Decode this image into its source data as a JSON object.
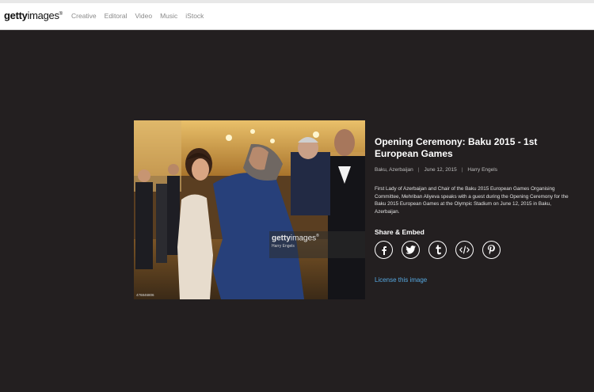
{
  "header": {
    "logo_bold": "getty",
    "logo_regular": "images",
    "logo_reg": "®",
    "nav": [
      "Creative",
      "Editoral",
      "Video",
      "Music",
      "iStock"
    ]
  },
  "image": {
    "watermark_brand_bold": "getty",
    "watermark_brand": "images",
    "watermark_reg": "®",
    "watermark_credit": "Harry Engels",
    "image_id": "476846806"
  },
  "details": {
    "title": "Opening Ceremony: Baku 2015 - 1st European Games",
    "location": "Baku, Azerbaijan",
    "date": "June 12, 2015",
    "photographer": "Harry Engels",
    "caption": "First Lady of Azerbaijan and Chair of the Baku 2015 European Games Organising Committee, Mehriban Aliyeva speaks with a guest during the Opening Ceremony for the Baku 2015 European Games at the Olympic Stadium on June 12, 2015 in Baku, Azerbaijan.",
    "share_label": "Share & Embed",
    "share_icons": [
      "facebook-icon",
      "twitter-icon",
      "tumblr-icon",
      "embed-icon",
      "pinterest-icon"
    ],
    "license_link": "License this image"
  }
}
